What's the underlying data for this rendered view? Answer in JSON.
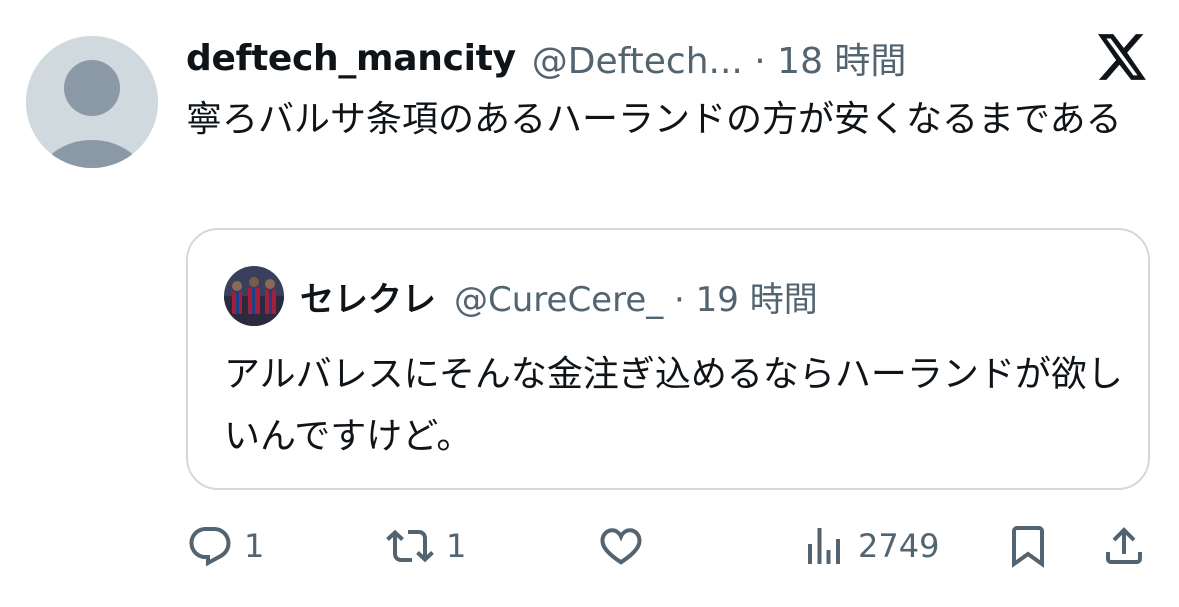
{
  "tweet": {
    "display_name": "deftech_mancity",
    "meta": "@Deftech... · 18 時間",
    "text": "寧ろバルサ条項のあるハーランドの方が安くなるまである"
  },
  "quote": {
    "display_name": "セレクレ",
    "meta": "@CureCere_ · 19 時間",
    "text": "アルバレスにそんな金注ぎ込めるならハーランドが欲しいんですけど。"
  },
  "actions": {
    "reply_count": "1",
    "retweet_count": "1",
    "view_count": "2749"
  },
  "colors": {
    "text_primary": "#0f1419",
    "text_secondary": "#536471",
    "border": "#cfd9de",
    "avatar_placeholder": "#cfd9de"
  },
  "icons": [
    "default-avatar-icon",
    "x-logo-icon",
    "reply-icon",
    "retweet-icon",
    "like-icon",
    "views-icon",
    "bookmark-icon",
    "share-icon"
  ]
}
